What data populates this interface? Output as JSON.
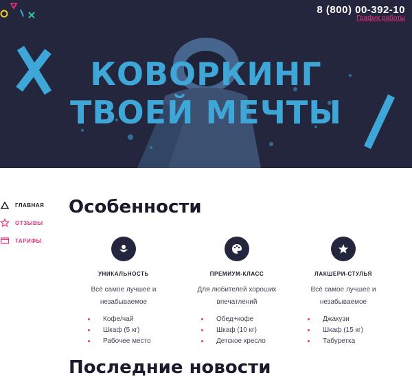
{
  "header": {
    "phone": "8 (800) 00-392-10",
    "schedule_link": "График работы"
  },
  "hero": {
    "line1": "Коворкинг",
    "line2": "твоей мечты"
  },
  "nav": [
    {
      "label": "ГЛАВНАЯ",
      "icon": "triangle-icon"
    },
    {
      "label": "ОТЗЫВЫ",
      "icon": "star-icon"
    },
    {
      "label": "ТАРИФЫ",
      "icon": "card-icon"
    }
  ],
  "features_section": {
    "title": "Особенности",
    "items": [
      {
        "icon": "flower-icon",
        "title": "УНИКАЛЬНОСТЬ",
        "desc": "Всё самое лучшее и незабываемое",
        "list": [
          "Кофе/чай",
          "Шкаф (5 кг)",
          "Рабочее место"
        ]
      },
      {
        "icon": "palette-icon",
        "title": "ПРЕМИУМ-КЛАСС",
        "desc": "Для любителей хороших впечатлений",
        "list": [
          "Обед+кофе",
          "Шкаф (10 кг)",
          "Детское кресло"
        ]
      },
      {
        "icon": "star-icon",
        "title": "ЛАКШЕРИ-СТУЛЬЯ",
        "desc": "Всё самое лучшее и незабываемое",
        "list": [
          "Джакузи",
          "Шкаф (15 кг)",
          "Табуретка"
        ]
      }
    ]
  },
  "news_section": {
    "title": "Последние новости"
  },
  "colors": {
    "hero_bg": "#24263e",
    "accent_blue": "#3fa7d8",
    "accent_pink": "#e2347c"
  }
}
